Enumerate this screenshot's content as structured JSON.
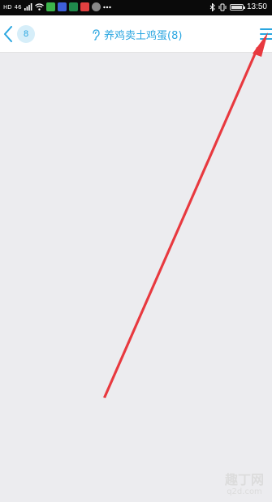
{
  "status_bar": {
    "left_text": "HD",
    "network": "46",
    "icons": [
      "signal-icon",
      "wifi-icon",
      "app-icon-green",
      "app-icon-blue",
      "app-icon-darkgreen",
      "app-icon-red",
      "app-icon-gray",
      "more-dots-icon"
    ],
    "right_icons": [
      "bluetooth-icon",
      "vibrate-icon",
      "battery-icon"
    ],
    "time": "13:50",
    "battery_level": 0.9
  },
  "nav": {
    "back_icon": "chevron-left-icon",
    "back_count": "8",
    "title_icon": "ear-icon",
    "title": "养鸡卖土鸡蛋(8)",
    "menu_icon": "hamburger-menu-icon"
  },
  "watermark": {
    "logo_text": "趣丁网",
    "url": "q2d.com"
  },
  "colors": {
    "accent": "#2aa6e0",
    "annotation_arrow": "#e8393f",
    "background": "#ececef"
  }
}
